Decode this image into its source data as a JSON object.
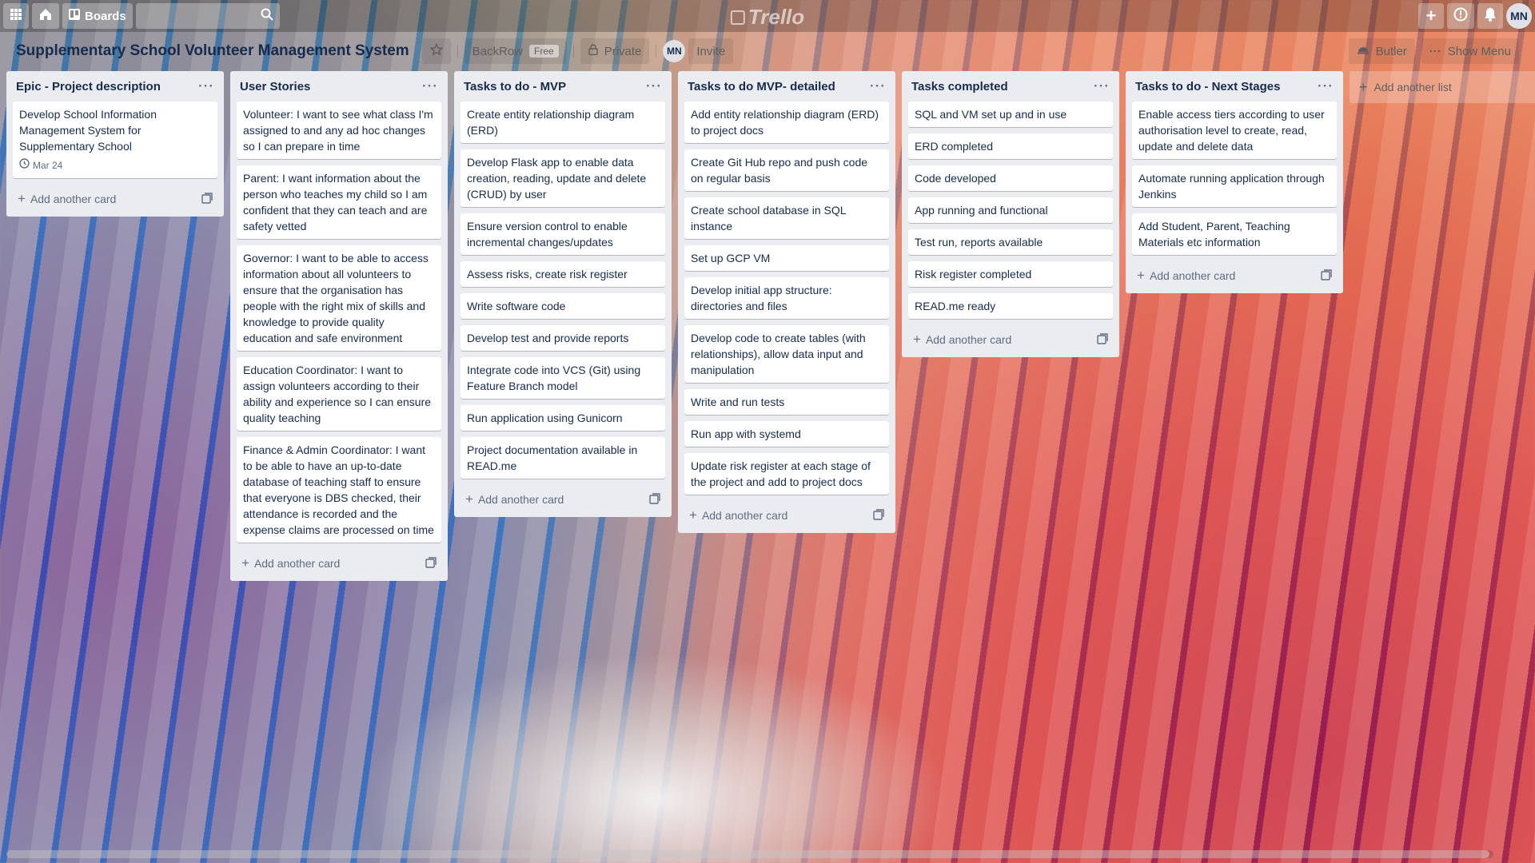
{
  "topbar": {
    "boards_label": "Boards",
    "logo": "Trello",
    "avatar_initials": "MN"
  },
  "board": {
    "title": "Supplementary School Volunteer Management System",
    "team": "BackRow",
    "team_badge": "Free",
    "visibility": "Private",
    "member_initials": "MN",
    "invite": "Invite",
    "butler": "Butler",
    "show_menu": "Show Menu"
  },
  "add_card_label": "Add another card",
  "add_list_label": "Add another list",
  "lists": [
    {
      "title": "Epic - Project description",
      "cards": [
        "Develop School Information Management System for Supplementary School"
      ],
      "due": "Mar 24"
    },
    {
      "title": "User Stories",
      "cards": [
        "Volunteer: I want to see what class I'm assigned to and any ad hoc changes so I can prepare in time",
        "Parent: I want information about the person who teaches my child so I am confident that they can teach and are safety vetted",
        "Governor: I want to be able to access information about all volunteers to ensure that the organisation has people with the right mix of skills and knowledge to provide quality education and safe environment",
        "Education Coordinator: I want to assign volunteers according to their ability and experience so I can ensure quality teaching",
        "Finance & Admin Coordinator: I want to be able to have an up-to-date database of teaching staff to ensure that everyone is DBS checked, their attendance is recorded and the expense claims are processed on time"
      ]
    },
    {
      "title": "Tasks to do - MVP",
      "cards": [
        "Create entity relationship diagram (ERD)",
        "Develop Flask app to enable data creation, reading, update and delete (CRUD) by user",
        "Ensure version control to enable incremental changes/updates",
        "Assess risks, create risk register",
        "Write software code",
        "Develop test and provide reports",
        "Integrate code into VCS (Git) using Feature Branch model",
        "Run application using Gunicorn",
        "Project documentation available in READ.me"
      ]
    },
    {
      "title": "Tasks to do MVP- detailed",
      "cards": [
        "Add entity relationship diagram (ERD) to project docs",
        "Create Git Hub repo and push code on regular basis",
        "Create school database in SQL instance",
        "Set up GCP VM",
        "Develop initial app structure: directories and files",
        "Develop code to create tables (with relationships), allow data input and manipulation",
        "Write and run tests",
        "Run app with systemd",
        "Update risk register at each stage of the project and add to project docs"
      ]
    },
    {
      "title": "Tasks completed",
      "cards": [
        "SQL and VM set up and in use",
        "ERD completed",
        "Code developed",
        "App running and functional",
        "Test run, reports available",
        "Risk register completed",
        "READ.me ready"
      ]
    },
    {
      "title": "Tasks to do - Next Stages",
      "cards": [
        "Enable access tiers according to user authorisation level to create, read, update and delete data",
        "Automate running application through Jenkins",
        "Add Student, Parent, Teaching Materials etc information"
      ]
    }
  ]
}
